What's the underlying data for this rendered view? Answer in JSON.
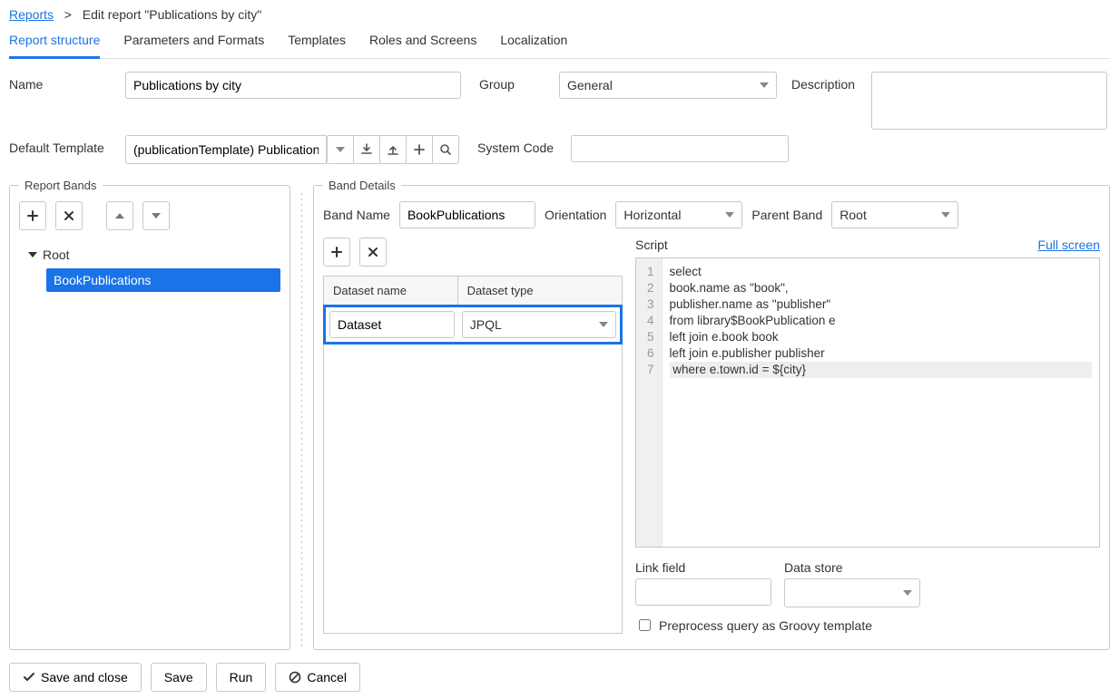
{
  "breadcrumb": {
    "root": "Reports",
    "current": "Edit report \"Publications by city\""
  },
  "tabs": [
    "Report structure",
    "Parameters and Formats",
    "Templates",
    "Roles and Screens",
    "Localization"
  ],
  "activeTab": 0,
  "fields": {
    "name_label": "Name",
    "name_value": "Publications by city",
    "group_label": "Group",
    "group_value": "General",
    "description_label": "Description",
    "description_value": "",
    "default_template_label": "Default Template",
    "default_template_value": "(publicationTemplate) Publication",
    "system_code_label": "System Code",
    "system_code_value": ""
  },
  "reportBands": {
    "legend": "Report Bands",
    "root": "Root",
    "child": "BookPublications"
  },
  "bandDetails": {
    "legend": "Band Details",
    "bandName_label": "Band Name",
    "bandName_value": "BookPublications",
    "orientation_label": "Orientation",
    "orientation_value": "Horizontal",
    "parentBand_label": "Parent Band",
    "parentBand_value": "Root",
    "dataset_name_header": "Dataset name",
    "dataset_type_header": "Dataset type",
    "dataset_name_value": "Dataset",
    "dataset_type_value": "JPQL",
    "script_label": "Script",
    "fullscreen": "Full screen",
    "script_lines": [
      "select",
      "book.name as \"book\",",
      "publisher.name as \"publisher\"",
      "from library$BookPublication e",
      "left join e.book book",
      "left join e.publisher publisher",
      " where e.town.id = ${city}"
    ],
    "linkfield_label": "Link field",
    "linkfield_value": "",
    "datastore_label": "Data store",
    "datastore_value": "",
    "preprocess_label": "Preprocess query as Groovy template"
  },
  "buttons": {
    "save_close": "Save and close",
    "save": "Save",
    "run": "Run",
    "cancel": "Cancel"
  }
}
